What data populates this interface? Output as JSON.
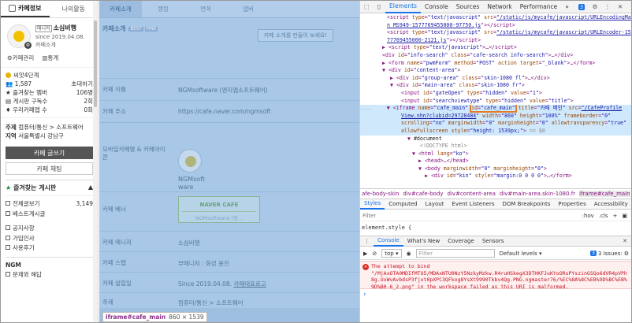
{
  "sidebar": {
    "tab_info": "카페정보",
    "tab_activity": "나의활동",
    "manager_tag": "매니저",
    "cafe_name": "소심비행",
    "since": "since 2019.04.08.",
    "intro_link": "카페소개",
    "link_manage": "카페관리",
    "link_stats": "통계",
    "grade": "씨앗4단계",
    "members_count": "1,587",
    "invite": "초대하기",
    "stats": [
      {
        "label": "즐겨찾는 멤버",
        "value": "106명"
      },
      {
        "label": "게시판 구독수",
        "value": "2회"
      },
      {
        "label": "우리카페앱 수",
        "value": "0회"
      }
    ],
    "topic_label": "주제",
    "topic_value": "컴퓨터/통신 > 소프트웨어",
    "region_label": "지역",
    "region_value": "서울특별시 강남구",
    "write_button": "카페 글쓰기",
    "chat_button": "카페 채팅",
    "fav_title": "즐겨찾는 게시판",
    "menu_items": [
      {
        "label": "전체글보기",
        "count": "3,149"
      },
      {
        "label": "베스트게시글",
        "count": ""
      }
    ],
    "menu_items2": [
      {
        "label": "공지사항"
      },
      {
        "label": "가입인사"
      },
      {
        "label": "사용후기"
      }
    ],
    "group_ngm": "NGM",
    "menu_items3": [
      {
        "label": "문제와 해답"
      }
    ]
  },
  "main": {
    "tabs": [
      "카페소개",
      "랭킹",
      "연혁",
      "앱버"
    ],
    "section_title": "카페소개",
    "badges": [
      "BEST",
      "PINK"
    ],
    "make_intro": "카페 소개를 만들어 보세요!",
    "rows": [
      {
        "label": "카페 이름",
        "value": "NGMsoftware (엔지엠소프트웨어)"
      },
      {
        "label": "카페 주소",
        "value": "https://cafe.naver.com/ngmsoft"
      },
      {
        "label": "모바일카페명 & 카페아이콘",
        "value": ""
      },
      {
        "label": "카페 배너",
        "value": ""
      },
      {
        "label": "카페 매니저",
        "value": "소심비행"
      },
      {
        "label": "카페 스텝",
        "value": "부매니저 : 화성 용진"
      },
      {
        "label": "카페 설립일",
        "value": "Since 2019.04.08."
      },
      {
        "label": "주제",
        "value": "컴퓨터/통신 > 소프트웨어"
      }
    ],
    "mobile_name": "NGMsoftware",
    "banner_title": "NAVER CAFE",
    "banner_sub": "NGMsoftware (엔...",
    "founded_link": "카페대표로고",
    "tooltip_tag": "iframe#cafe_main",
    "tooltip_size": "860 × 1539"
  },
  "devtools": {
    "tabs": [
      "Elements",
      "Console",
      "Sources",
      "Network",
      "Performance"
    ],
    "issues_badge": "3",
    "breadcrumb": [
      "afe-body-skin",
      "div#cafe-body",
      "div#content-area",
      "div#main-area.skin-1080.fr",
      "iframe#cafe_main"
    ],
    "style_tabs": [
      "Styles",
      "Computed",
      "Layout",
      "Event Listeners",
      "DOM Breakpoints",
      "Properties",
      "Accessibility"
    ],
    "filter_placeholder": "Filter",
    "hov": ":hov",
    "cls": ".cls",
    "element_style": "element.style {",
    "element_style_line": "  height: 1539px;",
    "console_tabs": [
      "Console",
      "What's New",
      "Coverage",
      "Sensors"
    ],
    "context": "top",
    "console_filter": "Filter",
    "levels": "Default levels",
    "issues_text": "3 Issues:",
    "issues_count": "3",
    "error_lines": [
      "The attempt to bind",
      "\"/MjAxOTA0MDIfMTU5/MDAxNTU0NzY5NzkyMzkw.R4ruHSkegX3DTHKFJuKYoORsPYszinGSQo6dVR4pVPh8g.UxWvAvbdsP3fjxt0pXPC3QFkog8YsXt9990Tkbv4Qg.PNG.ngmaster76/%EC%8A%8C%EB%9D%BC%EB%9D%B0-6_2.png\" in the workspace failed as this URI is malformed."
    ]
  }
}
